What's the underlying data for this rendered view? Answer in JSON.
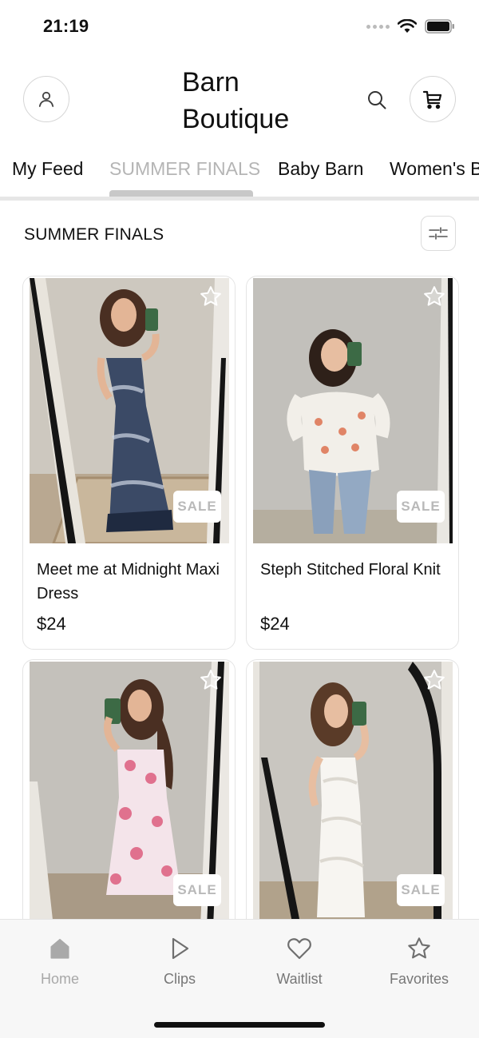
{
  "status": {
    "time": "21:19"
  },
  "header": {
    "brand": "Barn Boutique",
    "brand_line1": "Barn",
    "brand_line2": "Boutique"
  },
  "tabs": [
    {
      "label": "My Feed",
      "active": false
    },
    {
      "label": "SUMMER FINALS",
      "active": true
    },
    {
      "label": "Baby Barn",
      "active": false
    },
    {
      "label": "Women's Boutique",
      "active": false
    }
  ],
  "section": {
    "title": "SUMMER FINALS"
  },
  "products": [
    {
      "name": "Meet me at Midnight Maxi Dress",
      "price": "$24",
      "badge": "SALE",
      "icon": "star-outline-icon",
      "outfit": "navy-floral-maxi-dress"
    },
    {
      "name": "Steph Stitched Floral Knit",
      "price": "$24",
      "badge": "SALE",
      "icon": "star-outline-icon",
      "outfit": "white-floral-knit-sweater"
    },
    {
      "name": "",
      "price": "",
      "badge": "SALE",
      "icon": "star-outline-icon",
      "outfit": "pink-floral-dress"
    },
    {
      "name": "",
      "price": "",
      "badge": "SALE",
      "icon": "star-outline-icon",
      "outfit": "white-lace-dress"
    }
  ],
  "nav": [
    {
      "label": "Home",
      "icon": "home-icon",
      "active": true
    },
    {
      "label": "Clips",
      "icon": "play-icon",
      "active": false
    },
    {
      "label": "Waitlist",
      "icon": "heart-icon",
      "active": false
    },
    {
      "label": "Favorites",
      "icon": "star-icon",
      "active": false
    }
  ],
  "colors": {
    "accent_inactive": "#b5b5b5",
    "text": "#111111",
    "nav_bg": "#f7f7f7"
  }
}
